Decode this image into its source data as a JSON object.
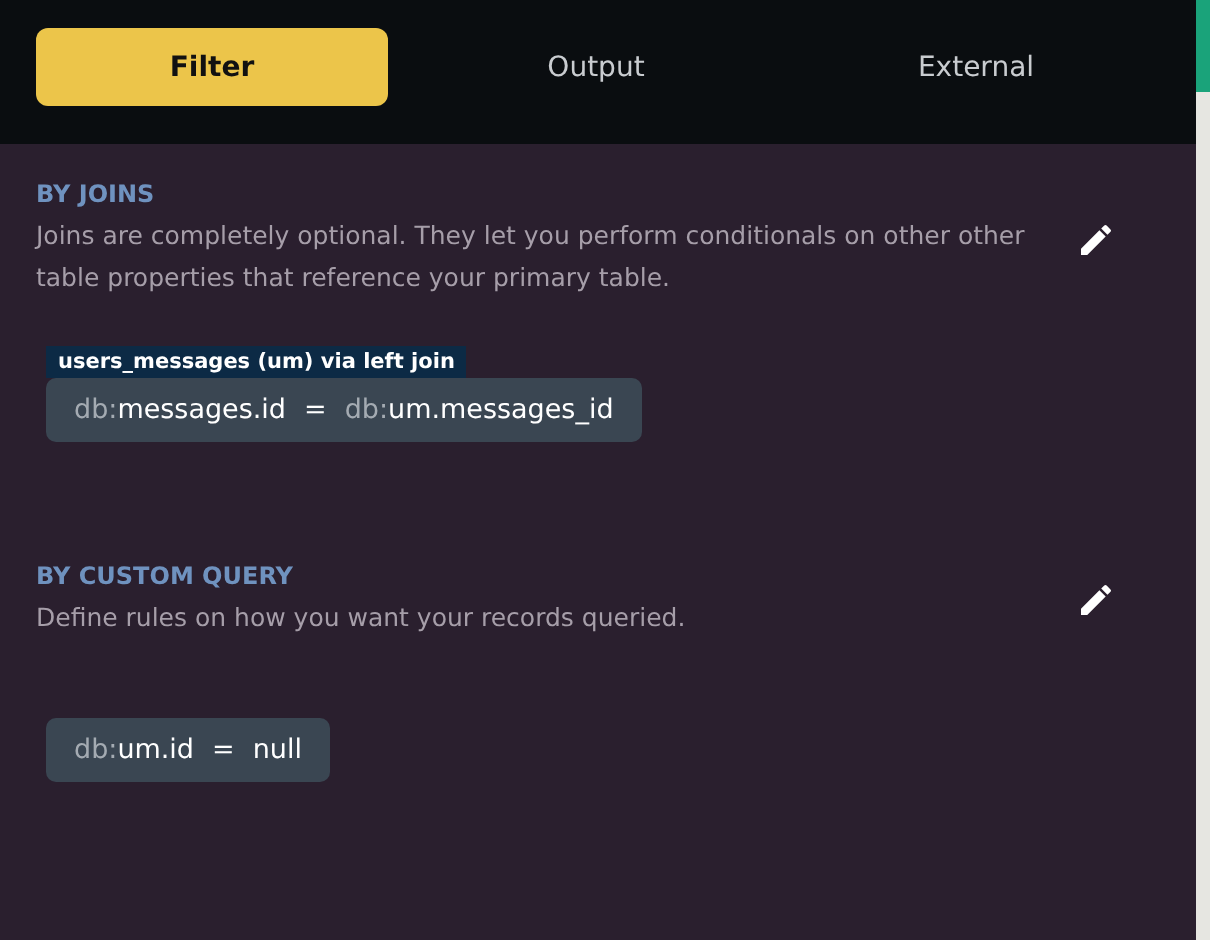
{
  "tabs": [
    {
      "label": "Filter",
      "selected": true
    },
    {
      "label": "Output",
      "selected": false
    },
    {
      "label": "External",
      "selected": false
    }
  ],
  "sections": [
    {
      "title": "BY JOINS",
      "description": "Joins are completely optional. They let you perform conditionals on other other table properties that reference your primary table.",
      "label": "users_messages (um) via left join",
      "condition": {
        "left_prefix": "db:",
        "left": "messages.id",
        "operator": "=",
        "right_prefix": "db:",
        "right": "um.messages_id"
      }
    },
    {
      "title": "BY CUSTOM QUERY",
      "description": "Define rules on how you want your records queried.",
      "condition": {
        "left_prefix": "db:",
        "left": "um.id",
        "operator": "=",
        "right": "null"
      }
    }
  ]
}
